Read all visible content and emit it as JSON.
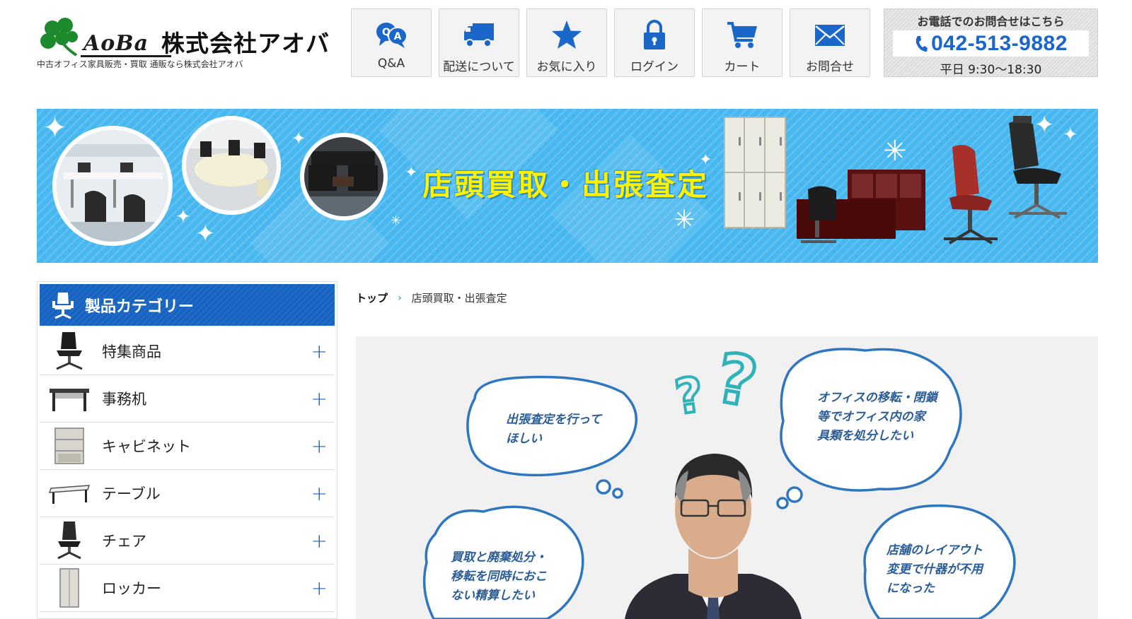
{
  "brand": {
    "logo_text": "AoBa",
    "company_name": "株式会社アオバ",
    "tagline": "中古オフィス家具販売・買取 通販なら株式会社アオバ"
  },
  "nav": {
    "items": [
      {
        "label": "Q&A",
        "icon": "qa-bubbles-icon"
      },
      {
        "label": "配送について",
        "icon": "delivery-truck-icon"
      },
      {
        "label": "お気に入り",
        "icon": "star-icon"
      },
      {
        "label": "ログイン",
        "icon": "lock-icon"
      },
      {
        "label": "カート",
        "icon": "cart-icon"
      },
      {
        "label": "お問合せ",
        "icon": "mail-icon"
      }
    ]
  },
  "contact": {
    "heading": "お電話でのお問合せはこちら",
    "phone": "042-513-9882",
    "hours": "平日 9:30〜18:30"
  },
  "banner": {
    "title": "店頭買取・出張査定",
    "background_color": "#47b7ef",
    "title_color": "#fff200"
  },
  "sidebar": {
    "heading": "製品カテゴリー",
    "items": [
      {
        "label": "特集商品",
        "icon": "office-chair-thumb"
      },
      {
        "label": "事務机",
        "icon": "desk-thumb"
      },
      {
        "label": "キャビネット",
        "icon": "cabinet-thumb"
      },
      {
        "label": "テーブル",
        "icon": "table-thumb"
      },
      {
        "label": "チェア",
        "icon": "mesh-chair-thumb"
      },
      {
        "label": "ロッカー",
        "icon": "locker-thumb"
      }
    ],
    "expand_symbol": "+",
    "accent_color": "#1663c1"
  },
  "breadcrumb": {
    "top": "トップ",
    "separator": "›",
    "current": "店頭買取・出張査定"
  },
  "illustration": {
    "bubbles": [
      {
        "lines": [
          "出張査定を行って",
          "ほしい"
        ]
      },
      {
        "lines": [
          "オフィスの移転・閉鎖",
          "等でオフィス内の家",
          "具類を処分したい"
        ]
      },
      {
        "lines": [
          "買取と廃棄処分・",
          "移転を同時におこ",
          "ない精算したい"
        ]
      },
      {
        "lines": [
          "店舗のレイアウト",
          "変更で什器が不用",
          "になった"
        ]
      }
    ],
    "question_marks": "??"
  }
}
